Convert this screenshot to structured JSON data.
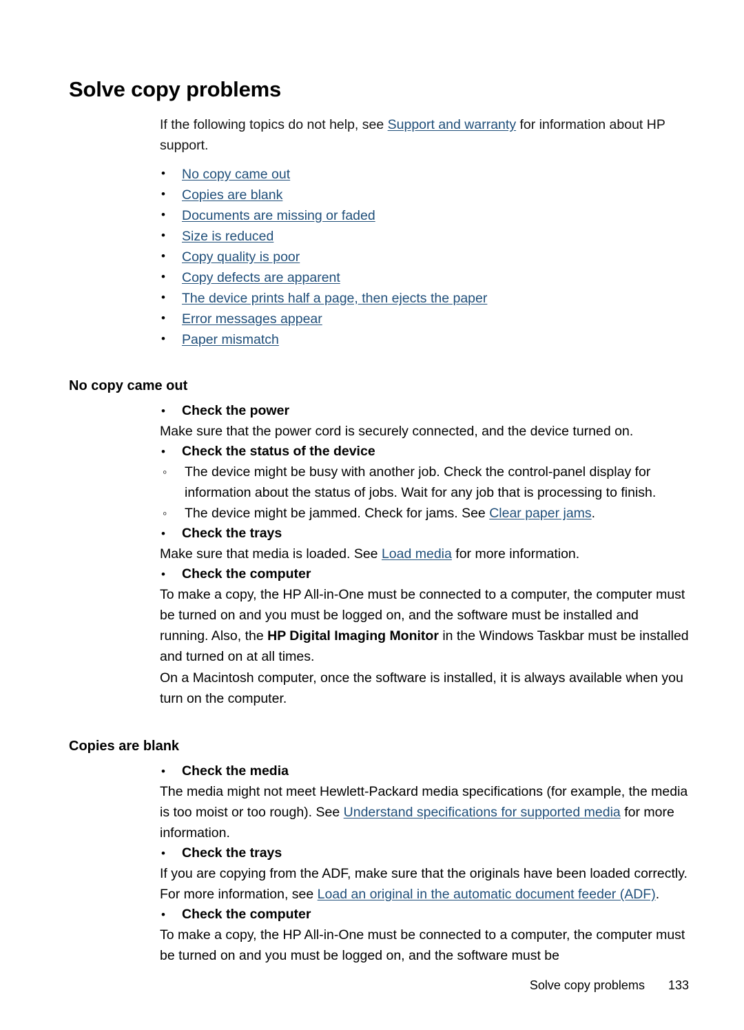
{
  "document": {
    "title": "Solve copy problems",
    "link_color": "#1f4e79",
    "text_color": "#000000",
    "background_color": "#ffffff"
  },
  "intro": {
    "before_link": "If the following topics do not help, see ",
    "link": "Support and warranty",
    "after_link": " for information about HP support."
  },
  "topic_links": [
    "No copy came out",
    "Copies are blank",
    "Documents are missing or faded",
    "Size is reduced",
    "Copy quality is poor",
    "Copy defects are apparent",
    "The device prints half a page, then ejects the paper",
    "Error messages appear",
    "Paper mismatch"
  ],
  "sections": [
    {
      "heading": "No copy came out",
      "checks": [
        {
          "title": "Check the power",
          "body": "Make sure that the power cord is securely connected, and the device turned on."
        },
        {
          "title": "Check the status of the device",
          "subitems": [
            {
              "text": "The device might be busy with another job. Check the control-panel display for information about the status of jobs. Wait for any job that is processing to finish."
            },
            {
              "before_link": "The device might be jammed. Check for jams. See ",
              "link": "Clear paper jams",
              "after_link": "."
            }
          ]
        },
        {
          "title": "Check the trays",
          "before_link": "Make sure that media is loaded. See ",
          "link": "Load media",
          "after_link": " for more information."
        },
        {
          "title": "Check the computer",
          "paragraph_1_part_1": "To make a copy, the HP All-in-One must be connected to a computer, the computer must be turned on and you must be logged on, and the software must be installed and running. Also, the ",
          "paragraph_1_bold": "HP Digital Imaging Monitor",
          "paragraph_1_part_2": " in the Windows Taskbar must be installed and turned on at all times.",
          "paragraph_2": "On a Macintosh computer, once the software is installed, it is always available when you turn on the computer."
        }
      ]
    },
    {
      "heading": "Copies are blank",
      "checks": [
        {
          "title": "Check the media",
          "before_link": "The media might not meet Hewlett-Packard media specifications (for example, the media is too moist or too rough). See ",
          "link": "Understand specifications for supported media",
          "after_link": " for more information."
        },
        {
          "title": "Check the trays",
          "before_link": "If you are copying from the ADF, make sure that the originals have been loaded correctly. For more information, see ",
          "link": "Load an original in the automatic document feeder (ADF)",
          "after_link": "."
        },
        {
          "title": "Check the computer",
          "body": "To make a copy, the HP All-in-One must be connected to a computer, the computer must be turned on and you must be logged on, and the software must be"
        }
      ]
    }
  ],
  "footer": {
    "title": "Solve copy problems",
    "page_number": "133"
  }
}
